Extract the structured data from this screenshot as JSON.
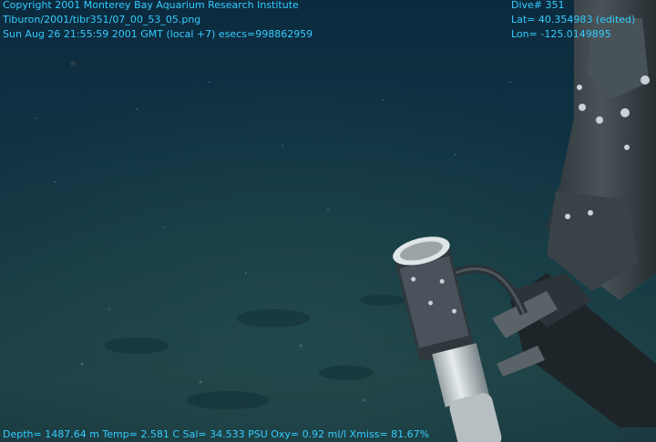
{
  "overlay": {
    "copyright": "Copyright 2001 Monterey Bay Aquarium Research Institute",
    "filename": "Tiburon/2001/tibr351/07_00_53_05.png",
    "datetime": "Sun Aug 26 21:55:59 2001 GMT (local +7)  esecs=998862959",
    "dive": "Dive# 351",
    "lat": "Lat= 40.354983 (edited)",
    "lon": "Lon= -125.0149895",
    "telemetry": "Depth= 1487.64 m  Temp= 2.581 C  Sal= 34.533 PSU  Oxy= 0.92 ml/l  Xmiss= 81.67%"
  },
  "colors": {
    "overlay_text": "#33ccff",
    "water": "#0f3243",
    "seafloor": "#1d4045",
    "arm": "#3a4448"
  }
}
